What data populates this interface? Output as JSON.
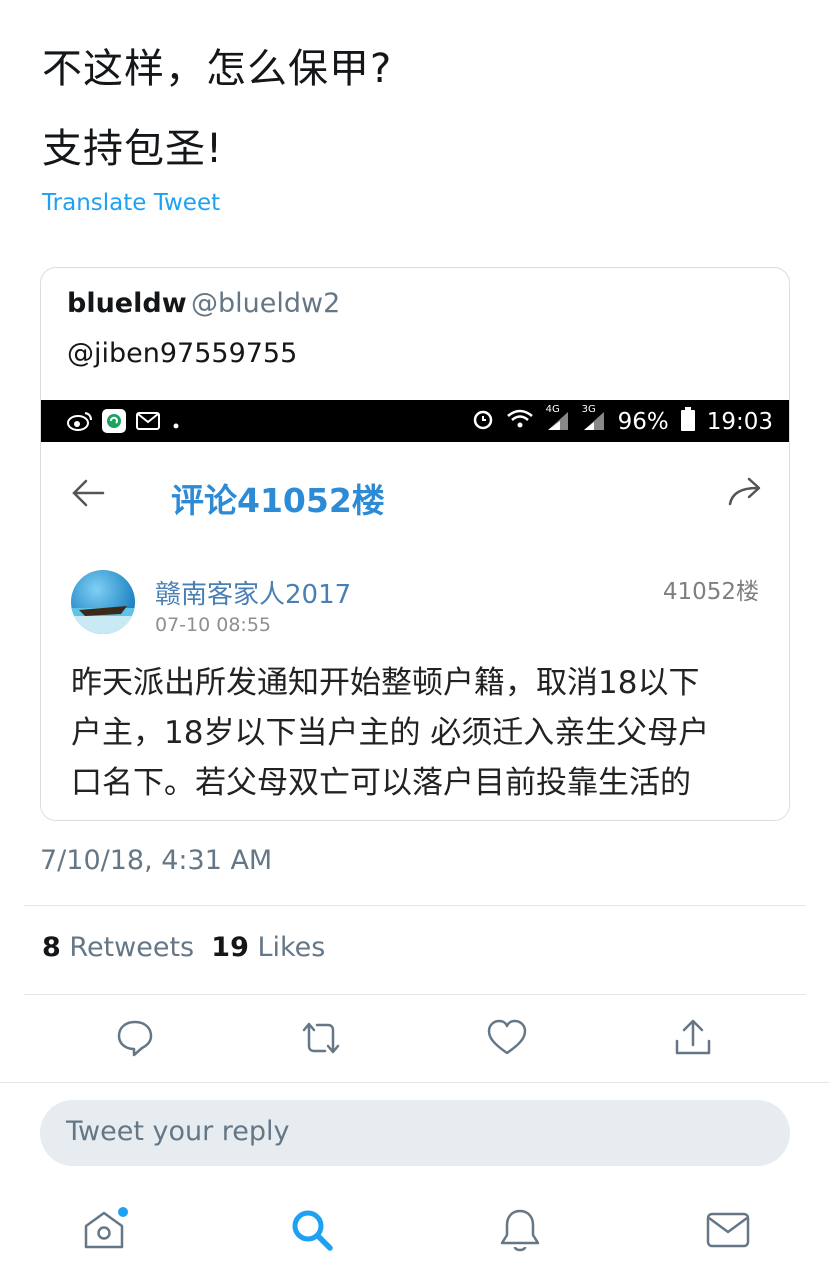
{
  "tweet": {
    "lines": [
      "不这样，怎么保甲?",
      "支持包圣!"
    ],
    "translate_label": "Translate Tweet",
    "timestamp": "7/10/18, 4:31 AM"
  },
  "quoted": {
    "name": "blueldw",
    "handle": "@blueldw2",
    "text": "@jiben97559755",
    "screenshot": {
      "status": {
        "battery": "96%",
        "time": "19:03",
        "net_4g": "4G",
        "net_3g": "3G"
      },
      "title": "评论41052楼",
      "user": "赣南客家人2017",
      "time": "07-10 08:55",
      "floor": "41052楼",
      "body_lines": [
        "昨天派出所发通知开始整顿户籍，取消18以下",
        "户主，18岁以下当户主的 必须迁入亲生父母户",
        "口名下。若父母双亡可以落户目前投靠生活的"
      ]
    }
  },
  "stats": {
    "retweets_count": "8",
    "retweets_label": "Retweets",
    "likes_count": "19",
    "likes_label": "Likes"
  },
  "reply": {
    "placeholder": "Tweet your reply"
  },
  "icons": {
    "actions": [
      "reply-icon",
      "retweet-icon",
      "like-icon",
      "share-icon"
    ],
    "tabs": [
      "home-icon",
      "search-icon",
      "notifications-icon",
      "messages-icon"
    ]
  },
  "colors": {
    "accent": "#1da1f2",
    "weibo_blue": "#2d8bd6",
    "muted": "#657786"
  }
}
